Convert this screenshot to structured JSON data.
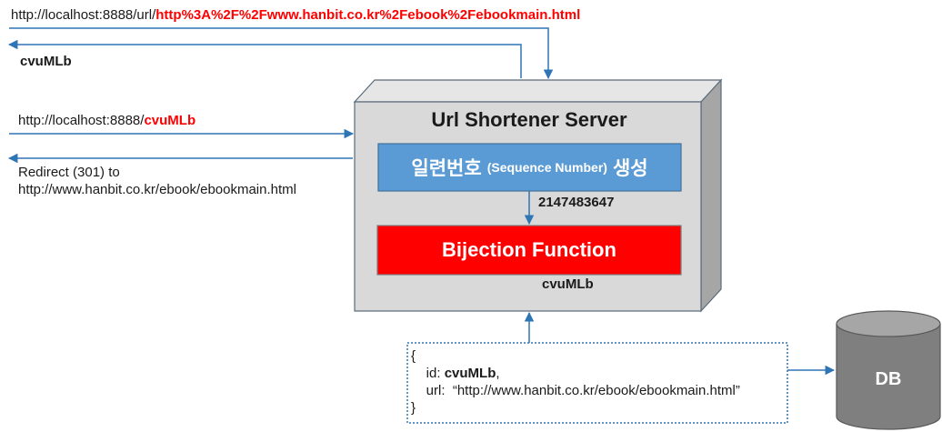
{
  "requests": {
    "long_url_prefix": "http://localhost:8888/url/",
    "long_url_encoded": "http%3A%2F%2Fwww.hanbit.co.kr%2Febook%2Febookmain.html",
    "short_code_response": "cvuMLb",
    "short_url_prefix": "http://localhost:8888/",
    "short_url_code": "cvuMLb",
    "redirect_line1": "Redirect (301) to",
    "redirect_line2": "http://www.hanbit.co.kr/ebook/ebookmain.html"
  },
  "server": {
    "title": "Url Shortener Server",
    "seq_korean_left": "일련번호",
    "seq_english": "(Sequence Number)",
    "seq_korean_right": "생성",
    "sequence_value": "2147483647",
    "bijection_label": "Bijection Function",
    "bijection_output": "cvuMLb"
  },
  "record": {
    "open": "{",
    "id_key": "id: ",
    "id_value": "cvuMLb",
    "id_suffix": ",",
    "url_line": "url:  “http://www.hanbit.co.kr/ebook/ebookmain.html”",
    "close": "}"
  },
  "db": {
    "label": "DB"
  },
  "colors": {
    "accent_blue": "#2e75b6",
    "seq_box_fill": "#5b9bd5",
    "bijection_fill": "#ff0000",
    "server_fill": "#d9d9d9",
    "db_fill": "#7f7f7f",
    "highlight_red": "#ff0000"
  }
}
